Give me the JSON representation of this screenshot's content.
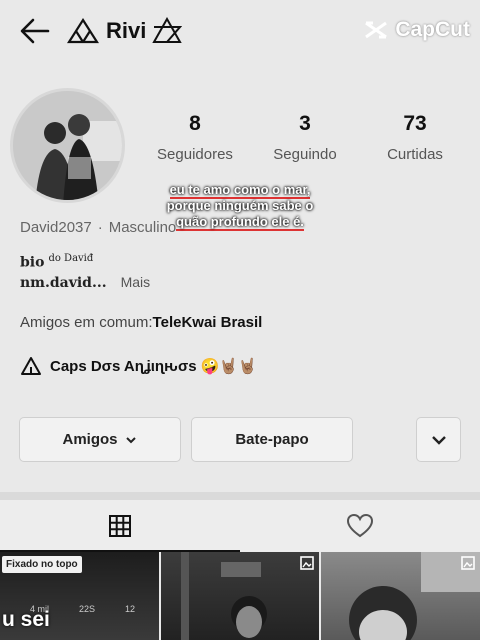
{
  "header": {
    "title": "Rivi",
    "watermark": "CapCut"
  },
  "profile": {
    "stats": [
      {
        "value": "8",
        "label": "Seguidores"
      },
      {
        "value": "3",
        "label": "Seguindo"
      },
      {
        "value": "73",
        "label": "Curtidas"
      }
    ],
    "username": "David2037",
    "gender": "Masculino",
    "bio_title": "bio",
    "bio_small": "do Daviđ",
    "bio_handle": "nm.david...",
    "bio_more": "Mais",
    "mutual_prefix": "Amigos em comum:",
    "mutual_name": "TeleKwai Brasil",
    "group_name": "Caps Dσs Aɳʝιɳԋσѕ 🤪🤘🏽🤘🏽"
  },
  "caption": {
    "line1": "eu te amo como o mar,",
    "line2": "porque ninguém sabe o",
    "line3": "quão profundo ele é."
  },
  "actions": {
    "friends_label": "Amigos",
    "chat_label": "Bate-papo"
  },
  "grid": {
    "pinned_label": "Fixado no topo",
    "cell1_word": "u sei",
    "cell1_stat_a": "4 mil",
    "cell1_stat_b": "22S",
    "cell1_stat_c": "12"
  }
}
